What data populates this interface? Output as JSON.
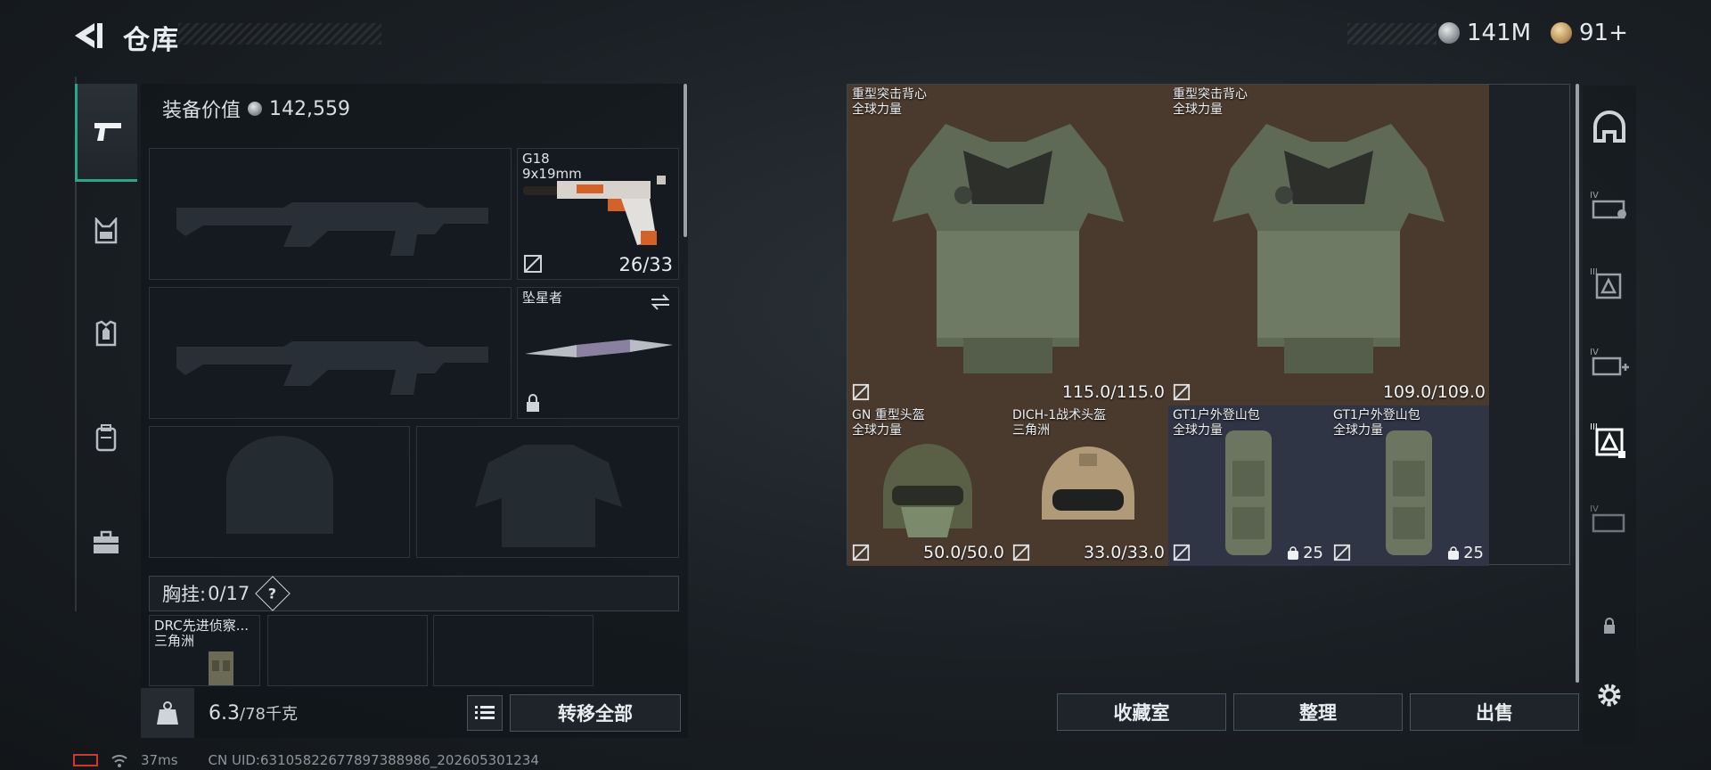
{
  "header": {
    "title": "仓库",
    "currency_silver": "141M",
    "currency_gold": "91+"
  },
  "loadout": {
    "equip_value_label": "装备价值",
    "equip_value": "142,559",
    "pistol": {
      "name": "G18",
      "caliber": "9x19mm",
      "ammo": "26/33"
    },
    "melee": {
      "name": "坠星者"
    },
    "chest_label": "胸挂:",
    "chest_capacity": "0/17",
    "help_glyph": "?",
    "chest_item": {
      "name": "DRC先进侦察...",
      "source": "三角洲"
    },
    "weight_value": "6.3",
    "weight_max": "/78千克",
    "transfer_all": "转移全部"
  },
  "stash": {
    "items": [
      {
        "name": "重型突击背心",
        "source": "全球力量",
        "durability": "115.0/115.0"
      },
      {
        "name": "重型突击背心",
        "source": "全球力量",
        "durability": "109.0/109.0"
      },
      {
        "name": "GN 重型头盔",
        "source": "全球力量",
        "durability": "50.0/50.0"
      },
      {
        "name": "DICH-1战术头盔",
        "source": "三角洲",
        "durability": "33.0/33.0"
      },
      {
        "name": "GT1户外登山包",
        "source": "全球力量",
        "capacity": "25"
      },
      {
        "name": "GT1户外登山包",
        "source": "全球力量",
        "capacity": "25"
      }
    ]
  },
  "actions": {
    "collection": "收藏室",
    "organize": "整理",
    "sell": "出售"
  },
  "right_tabs": [
    {
      "icon": "helmet-icon"
    },
    {
      "icon": "armor-iv-icon",
      "label": "IV"
    },
    {
      "icon": "armor-iii-icon",
      "label": "III"
    },
    {
      "icon": "medkit-iv-icon",
      "label": "IV"
    },
    {
      "icon": "armor-iii-selected-icon",
      "label": "III"
    },
    {
      "icon": "armor-iv-icon",
      "label": "IV"
    }
  ],
  "status": {
    "ping": "37ms",
    "uid": "CN UID:631058226778973889​86_202605301234"
  },
  "colors": {
    "accent": "#2ea58a",
    "vest_bg": "#4a3a2e",
    "backpack_bg": "#2f3545"
  }
}
